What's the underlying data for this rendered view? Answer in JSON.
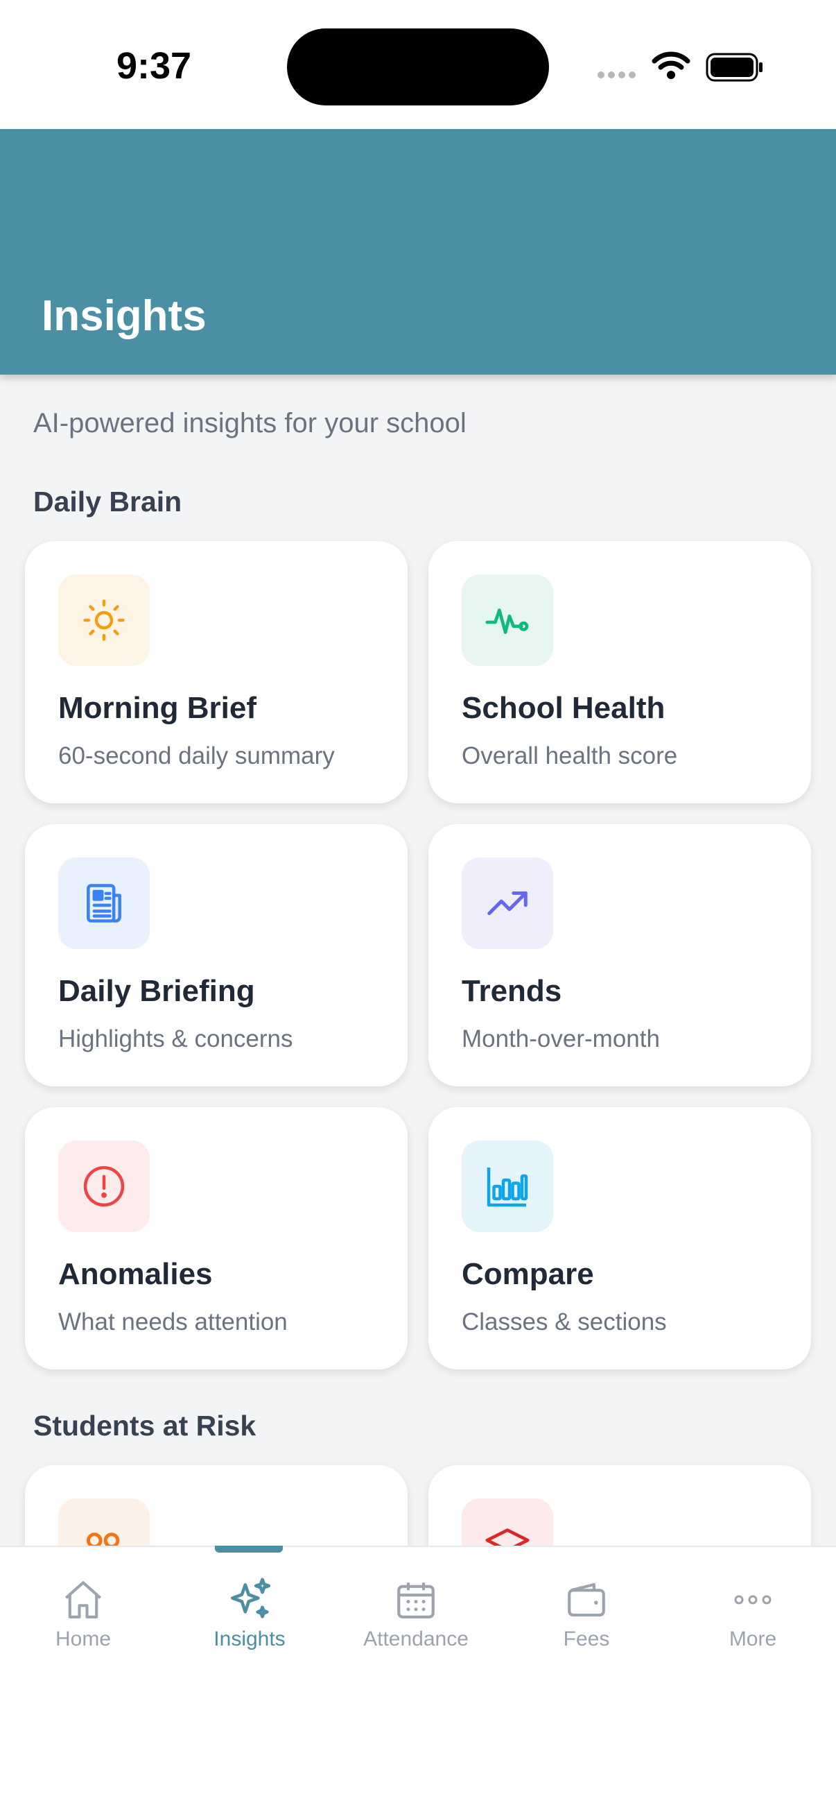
{
  "status_bar": {
    "time": "9:37"
  },
  "header": {
    "title": "Insights"
  },
  "subtitle": "AI-powered insights for your school",
  "sections": {
    "daily_brain": {
      "title": "Daily Brain"
    },
    "students_at_risk": {
      "title": "Students at Risk"
    }
  },
  "cards": [
    {
      "title": "Morning Brief",
      "subtitle": "60-second daily summary",
      "icon": "sun-icon",
      "icon_color": "#f59e0b",
      "icon_bg": "#fef4e6"
    },
    {
      "title": "School Health",
      "subtitle": "Overall health score",
      "icon": "pulse-icon",
      "icon_color": "#10b981",
      "icon_bg": "#e7f7f0"
    },
    {
      "title": "Daily Briefing",
      "subtitle": "Highlights & concerns",
      "icon": "newspaper-icon",
      "icon_color": "#3b82f6",
      "icon_bg": "#e9f0fe"
    },
    {
      "title": "Trends",
      "subtitle": "Month-over-month",
      "icon": "trending-up-icon",
      "icon_color": "#6366f1",
      "icon_bg": "#efeefc"
    },
    {
      "title": "Anomalies",
      "subtitle": "What needs attention",
      "icon": "alert-circle-icon",
      "icon_color": "#ef4444",
      "icon_bg": "#fdecec"
    },
    {
      "title": "Compare",
      "subtitle": "Classes & sections",
      "icon": "bar-chart-icon",
      "icon_color": "#0ea5e9",
      "icon_bg": "#e3f4fb"
    }
  ],
  "risk_cards": [
    {
      "icon": "users-icon",
      "icon_color": "#f97316",
      "icon_bg": "#fef1e7"
    },
    {
      "icon": "graduation-cap-icon",
      "icon_color": "#dc2626",
      "icon_bg": "#fdeaea"
    }
  ],
  "nav": [
    {
      "label": "Home",
      "icon": "home-icon",
      "active": false
    },
    {
      "label": "Insights",
      "icon": "sparkles-icon",
      "active": true
    },
    {
      "label": "Attendance",
      "icon": "calendar-icon",
      "active": false
    },
    {
      "label": "Fees",
      "icon": "wallet-icon",
      "active": false
    },
    {
      "label": "More",
      "icon": "more-icon",
      "active": false
    }
  ],
  "colors": {
    "accent": "#4a8fa4",
    "background": "#f3f4f6",
    "nav_inactive": "#9ca3af"
  }
}
